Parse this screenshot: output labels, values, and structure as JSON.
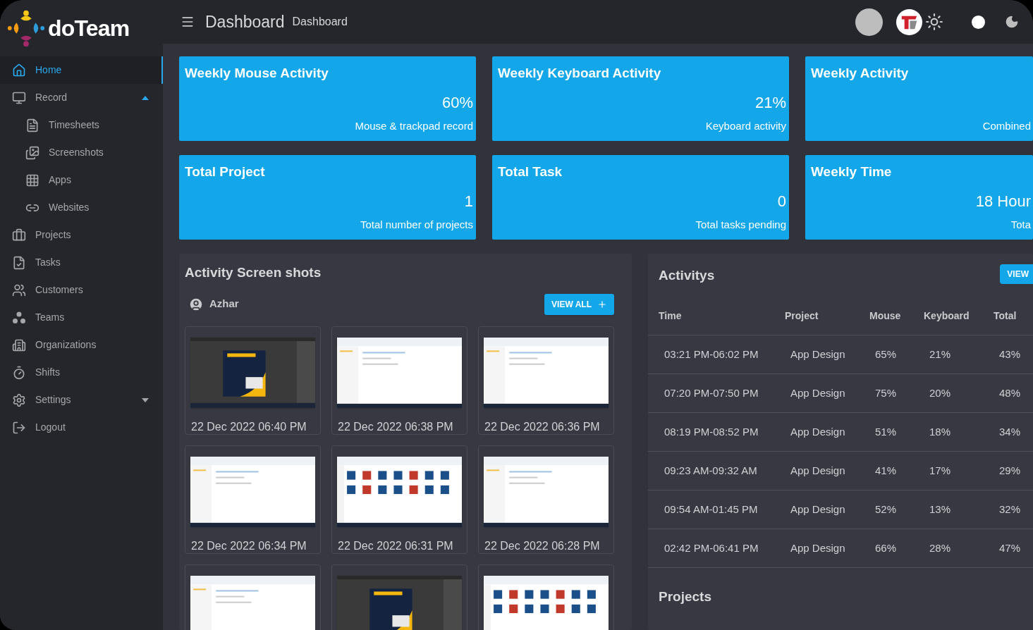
{
  "brand": {
    "name": "doTeam"
  },
  "header": {
    "title": "Dashboard",
    "breadcrumb": "Dashboard"
  },
  "sidebar": {
    "items": [
      {
        "label": "Home",
        "selected": true
      },
      {
        "label": "Record",
        "selected": false,
        "expanded": true,
        "children": [
          {
            "label": "Timesheets",
            "selected": false
          },
          {
            "label": "Screenshots",
            "selected": false
          },
          {
            "label": "Apps",
            "selected": false
          },
          {
            "label": "Websites",
            "selected": false
          }
        ]
      },
      {
        "label": "Projects",
        "selected": false
      },
      {
        "label": "Tasks",
        "selected": false
      },
      {
        "label": "Customers",
        "selected": false
      },
      {
        "label": "Teams",
        "selected": false
      },
      {
        "label": "Organizations",
        "selected": false
      },
      {
        "label": "Shifts",
        "selected": false
      },
      {
        "label": "Settings",
        "selected": false,
        "expanded": false
      },
      {
        "label": "Logout",
        "selected": false
      }
    ]
  },
  "stat_cards": [
    {
      "title": "Weekly Mouse Activity",
      "value": "60%",
      "caption": "Mouse & trackpad record"
    },
    {
      "title": "Weekly Keyboard Activity",
      "value": "21%",
      "caption": "Keyboard activity"
    },
    {
      "title": "Weekly Activity",
      "caption": "Combined"
    },
    {
      "title": "Total Project",
      "value": "1",
      "caption": "Total number of projects"
    },
    {
      "title": "Total Task",
      "value": "0",
      "caption": "Total tasks pending"
    },
    {
      "title": "Weekly Time",
      "value": "18 Hour",
      "caption": "Tota"
    }
  ],
  "screenshots": {
    "title": "Activity Screen shots",
    "user": "Azhar",
    "button": "VIEW ALL",
    "items": [
      {
        "kind": "picture",
        "time": "22 Dec 2022 06:40 PM"
      },
      {
        "kind": "picture",
        "time": "22 Dec 2022 06:38 PM"
      },
      {
        "kind": "picture",
        "time": "22 Dec 2022 06:36 PM"
      },
      {
        "kind": "picture",
        "time": "22 Dec 2022 06:34 PM"
      },
      {
        "kind": "picture",
        "time": "22 Dec 2022 06:31 PM"
      },
      {
        "kind": "picture",
        "time": "22 Dec 2022 06:28 PM"
      },
      {
        "kind": "picture"
      },
      {
        "kind": "picture"
      },
      {
        "kind": "picture"
      }
    ]
  },
  "activities": {
    "title": "Activitys",
    "button": "VIEW",
    "columns": [
      "Time",
      "Project",
      "Mouse",
      "Keyboard",
      "Total"
    ],
    "rows": [
      [
        "03:21 PM-06:02 PM",
        "App Design",
        "65%",
        "21%",
        "43%"
      ],
      [
        "07:20 PM-07:50 PM",
        "App Design",
        "75%",
        "20%",
        "48%"
      ],
      [
        "08:19 PM-08:52 PM",
        "App Design",
        "51%",
        "18%",
        "34%"
      ],
      [
        "09:23 AM-09:32 AM",
        "App Design",
        "41%",
        "17%",
        "29%"
      ],
      [
        "09:54 AM-01:45 PM",
        "App Design",
        "52%",
        "13%",
        "32%"
      ],
      [
        "02:42 PM-06:41 PM",
        "App Design",
        "66%",
        "28%",
        "47%"
      ]
    ]
  },
  "projects": {
    "title": "Projects"
  }
}
